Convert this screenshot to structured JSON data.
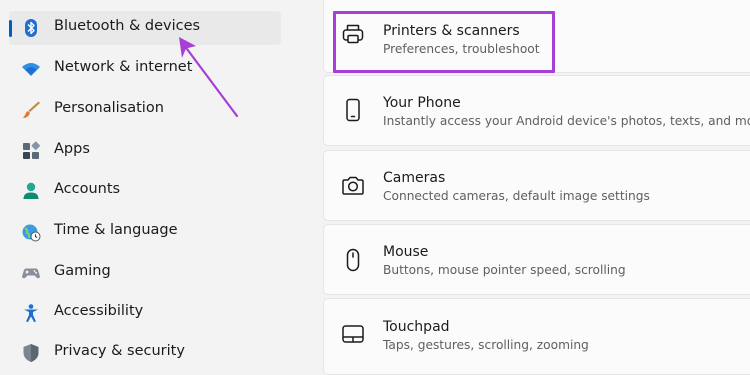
{
  "sidebar": {
    "items": [
      {
        "label": "Bluetooth & devices",
        "icon": "bluetooth-icon",
        "selected": true
      },
      {
        "label": "Network & internet",
        "icon": "wifi-icon"
      },
      {
        "label": "Personalisation",
        "icon": "brush-icon"
      },
      {
        "label": "Apps",
        "icon": "apps-icon"
      },
      {
        "label": "Accounts",
        "icon": "account-icon"
      },
      {
        "label": "Time & language",
        "icon": "globe-clock-icon"
      },
      {
        "label": "Gaming",
        "icon": "gamepad-icon"
      },
      {
        "label": "Accessibility",
        "icon": "accessibility-icon"
      },
      {
        "label": "Privacy & security",
        "icon": "shield-icon"
      }
    ]
  },
  "main": {
    "cards": [
      {
        "title": "Printers & scanners",
        "subtitle": "Preferences, troubleshoot",
        "icon": "printer-icon"
      },
      {
        "title": "Your Phone",
        "subtitle": "Instantly access your Android device's photos, texts, and more",
        "icon": "phone-icon"
      },
      {
        "title": "Cameras",
        "subtitle": "Connected cameras, default image settings",
        "icon": "camera-icon"
      },
      {
        "title": "Mouse",
        "subtitle": "Buttons, mouse pointer speed, scrolling",
        "icon": "mouse-icon"
      },
      {
        "title": "Touchpad",
        "subtitle": "Taps, gestures, scrolling, zooming",
        "icon": "touchpad-icon"
      }
    ]
  },
  "colors": {
    "accent": "#005fb8",
    "annotation": "#a73fd6",
    "background": "#f3f3f3",
    "card": "#fbfbfb"
  }
}
